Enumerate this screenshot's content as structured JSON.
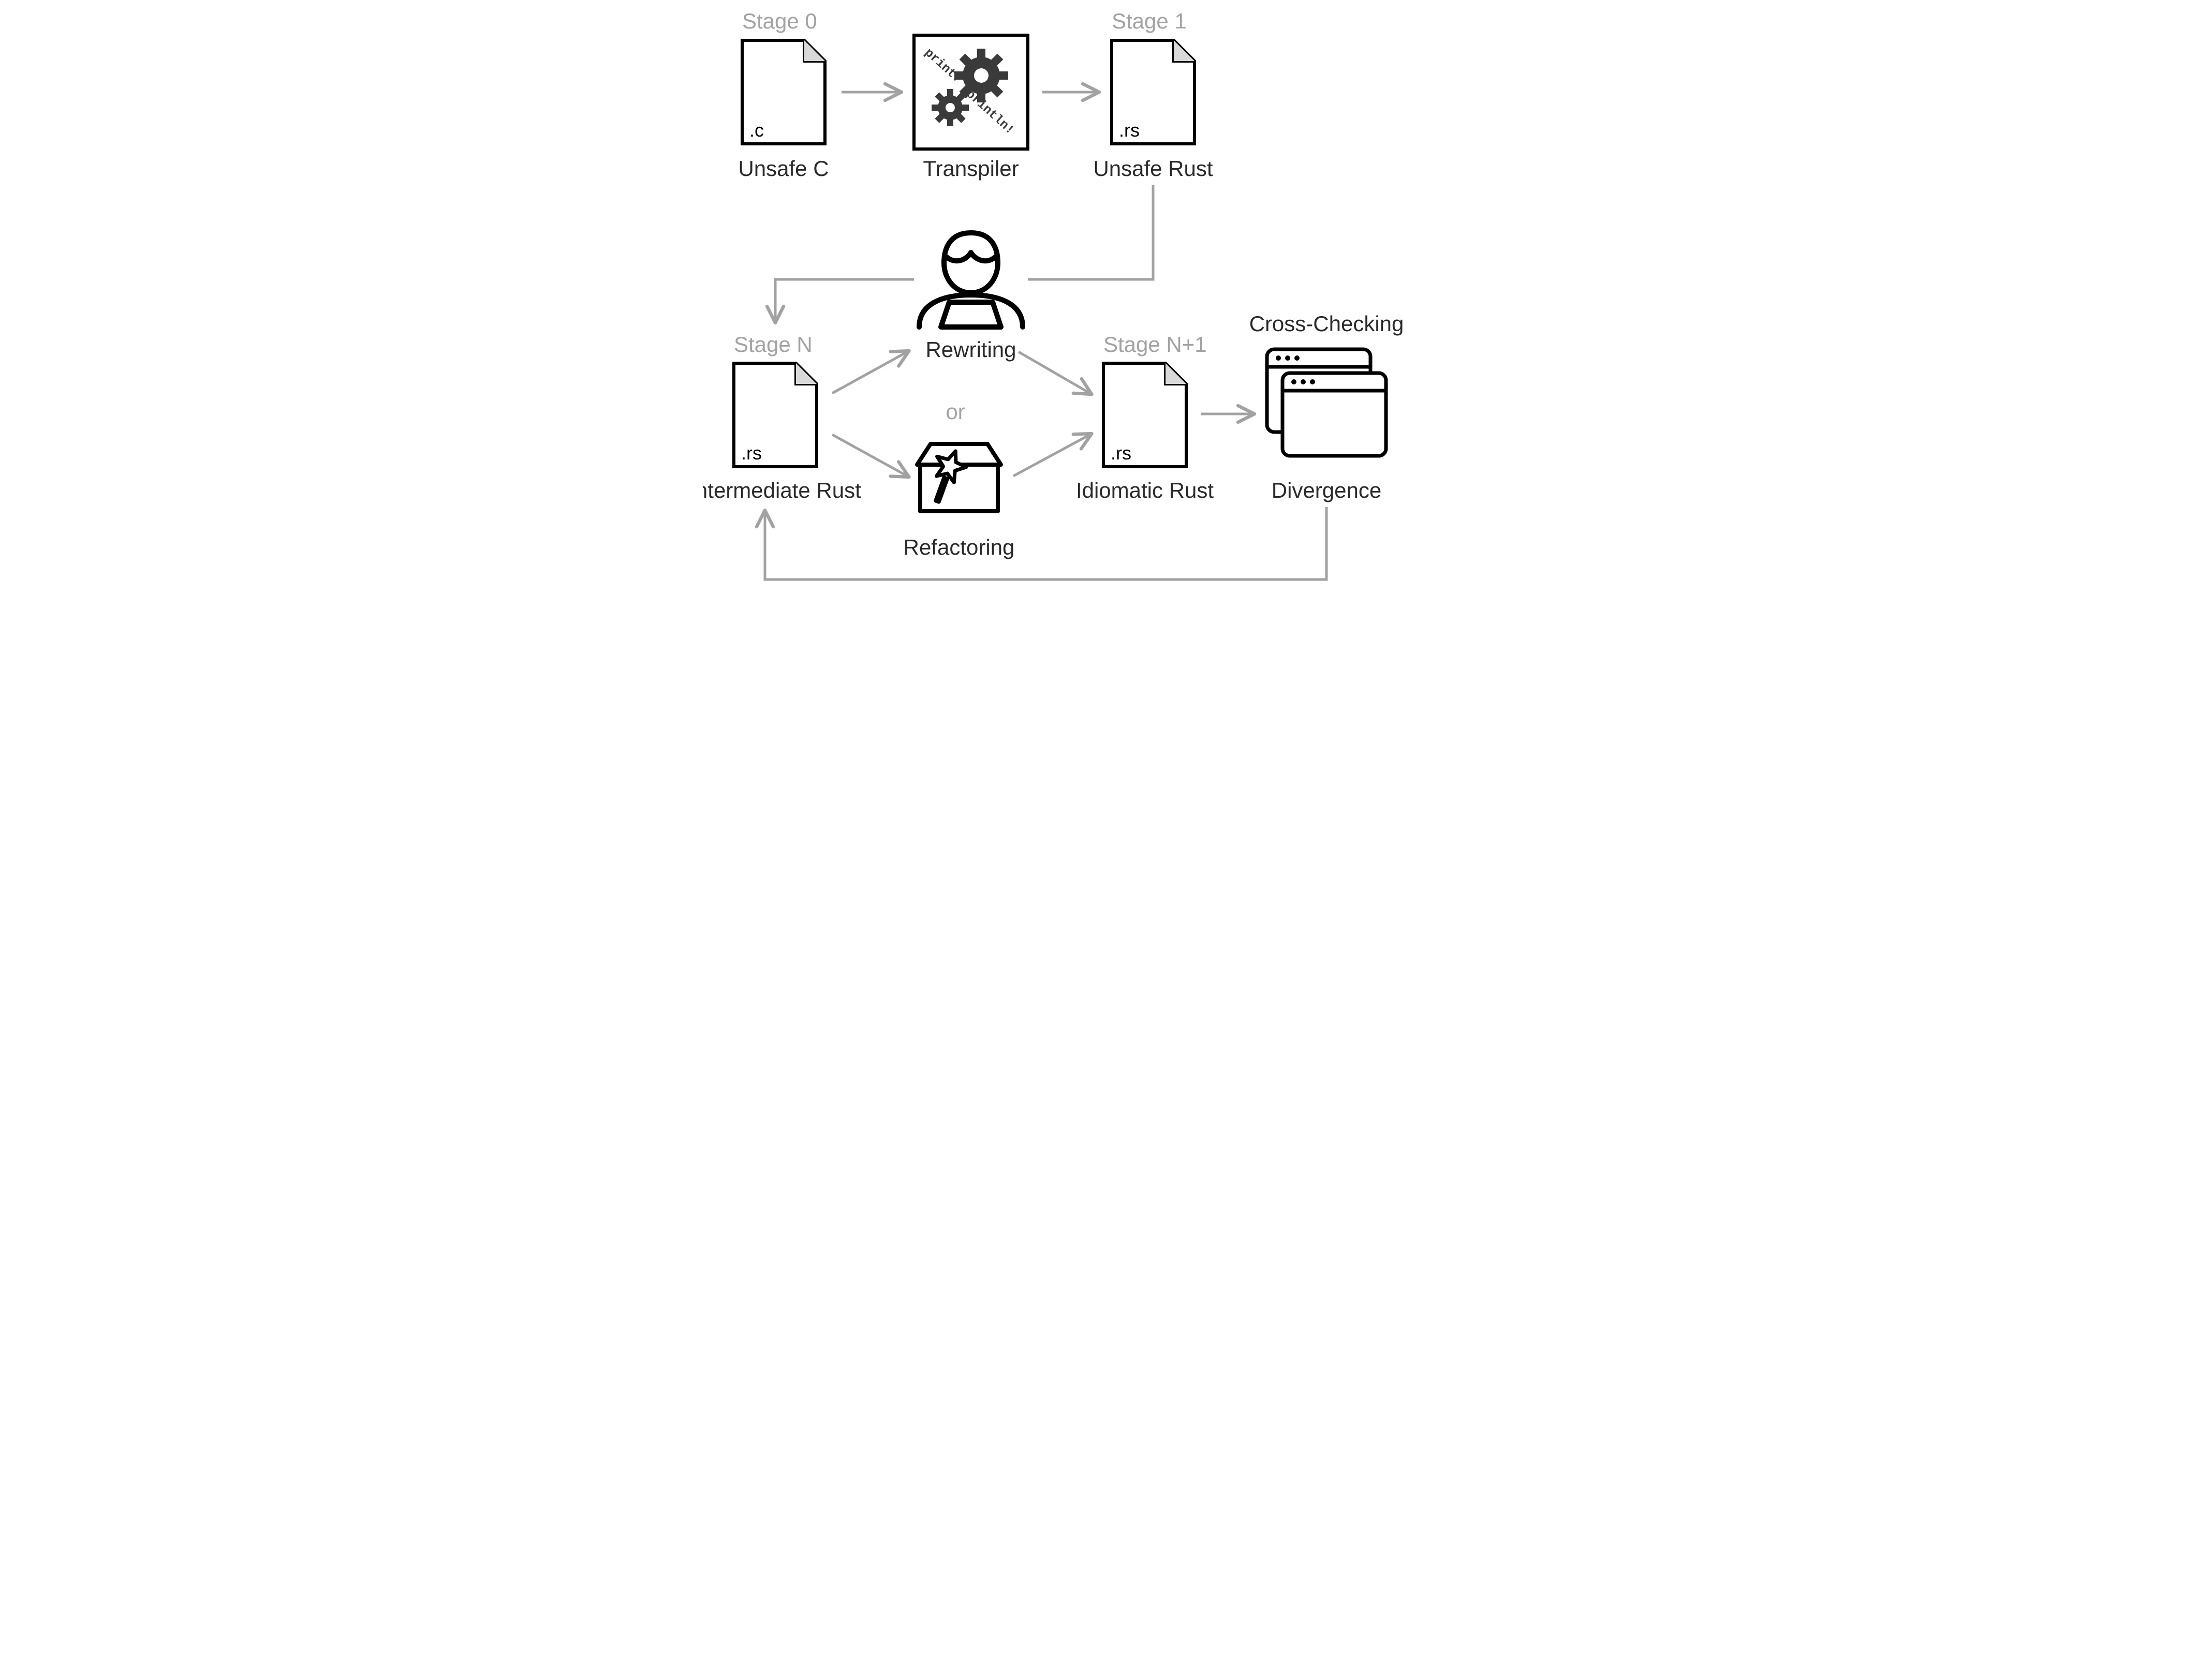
{
  "stages": {
    "s0": "Stage 0",
    "s1": "Stage 1",
    "sn": "Stage N",
    "sn1": "Stage N+1"
  },
  "labels": {
    "unsafeC": "Unsafe C",
    "transpiler": "Transpiler",
    "unsafeRust": "Unsafe Rust",
    "rewriting": "Rewriting",
    "or": "or",
    "refactoring": "Refactoring",
    "intermediate": "Intermediate Rust",
    "idiomatic": "Idiomatic Rust",
    "cross": "Cross-Checking",
    "divergence": "Divergence"
  },
  "ext": {
    "c": ".c",
    "rs": ".rs"
  },
  "transpilerCode": {
    "in": "printf",
    "out": "println!"
  }
}
